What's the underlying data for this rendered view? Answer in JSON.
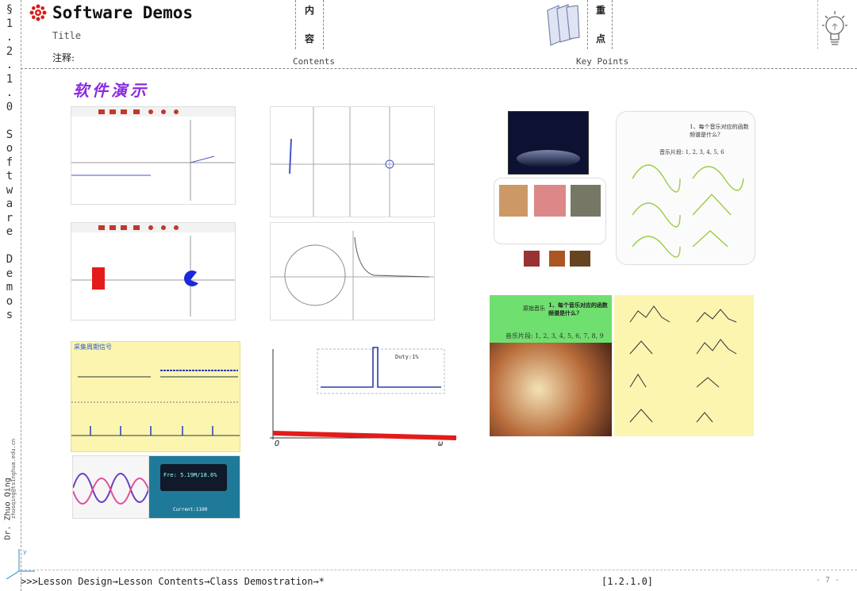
{
  "header": {
    "section_title": "Software Demos",
    "title_label": "Title",
    "note_label": "注释:",
    "contents_cn_1": "内",
    "contents_cn_2": "容",
    "contents_en": "Contents",
    "keypoints_cn_1": "重",
    "keypoints_cn_2": "点",
    "keypoints_en": "Key Points"
  },
  "sidebar": {
    "section_chars": [
      "§",
      "1",
      ".",
      "2",
      ".",
      "1",
      ".",
      "0",
      " ",
      "S",
      "o",
      "f",
      "t",
      "w",
      "a",
      "r",
      "e",
      " ",
      "D",
      "e",
      "m",
      "o",
      "s"
    ],
    "author": "Dr. Zhuo Qing",
    "email": "zhuoqing@tsinghua.edu.cn"
  },
  "main": {
    "heading": "软件演示",
    "demo_labels": {
      "duty": "Duty:1%",
      "current": "Current:1100",
      "freq_display": "Fre: 5.19M/18.6%",
      "periodic_title": "采集周期信号",
      "music_question": "1、每个音乐对应的函数频谱是什么?",
      "music_clips_small": "音乐片段: 1, 2, 3, 4, 5, 6",
      "music_clips": "音乐片段: 1, 2, 3, 4, 5, 6, 7, 8, 9",
      "music_label": "原始音乐",
      "axis_o": "O",
      "axis_omega": "ω"
    }
  },
  "footer": {
    "breadcrumb": ">>>Lesson Design→Lesson Contents→Class Demostration→*",
    "section_code": "[1.2.1.0]",
    "page_number": "- 7 -"
  },
  "colors": {
    "accent_red": "#d81b1b",
    "heading_purple": "#8a2be2",
    "panel_yellow": "#fbf5b0",
    "panel_green": "#6fe06f"
  }
}
